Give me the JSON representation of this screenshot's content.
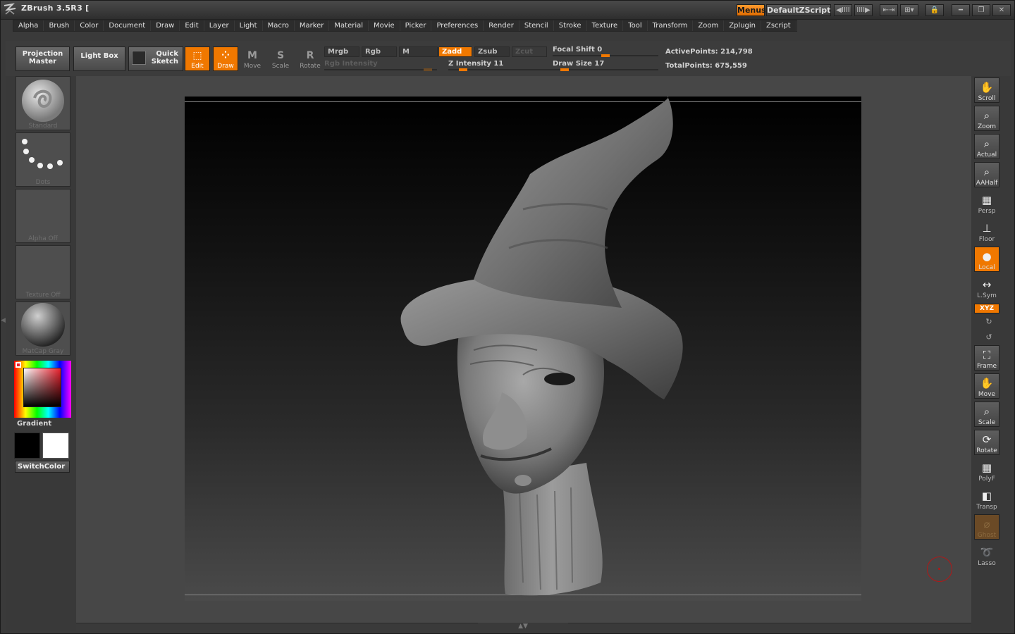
{
  "window": {
    "title": "ZBrush 3.5R3 [",
    "menus_button": "Menus",
    "script_name": "DefaultZScript",
    "controls": [
      "◀IIII",
      "IIII▶",
      "⇤⇥",
      "⊞▾",
      "🔒",
      "━",
      "❐",
      "✕"
    ]
  },
  "menubar": [
    "Alpha",
    "Brush",
    "Color",
    "Document",
    "Draw",
    "Edit",
    "Layer",
    "Light",
    "Macro",
    "Marker",
    "Material",
    "Movie",
    "Picker",
    "Preferences",
    "Render",
    "Stencil",
    "Stroke",
    "Texture",
    "Tool",
    "Transform",
    "Zoom",
    "Zplugin",
    "Zscript"
  ],
  "shelf": {
    "projection_master_1": "Projection",
    "projection_master_2": "Master",
    "light_box": "Light Box",
    "quick_sketch_1": "Quick",
    "quick_sketch_2": "Sketch",
    "edit": "Edit",
    "draw": "Draw",
    "move": "Move",
    "scale": "Scale",
    "rotate": "Rotate",
    "mrgb": "Mrgb",
    "rgb": "Rgb",
    "m": "M",
    "zadd": "Zadd",
    "zsub": "Zsub",
    "zcut": "Zcut",
    "rgb_intensity": "Rgb  Intensity",
    "z_intensity": "Z  Intensity 11",
    "focal_shift": "Focal  Shift 0",
    "draw_size": "Draw  Size 17",
    "active_points": "ActivePoints: 214,798",
    "total_points": "TotalPoints: 675,559"
  },
  "levels": {
    "rgb_intensity": 0.95,
    "z_intensity": 0.11,
    "focal_shift": 0.5,
    "draw_size": 0.08
  },
  "left_tray": {
    "brush": "Standard",
    "stroke": "Dots",
    "alpha": "Alpha  Off",
    "texture": "Texture  Off",
    "material": "MatCap  Gray",
    "gradient": "Gradient",
    "switch_color": "SwitchColor",
    "main_color": "#000000",
    "secondary_color": "#ffffff"
  },
  "right_tray": {
    "scroll": "Scroll",
    "zoom": "Zoom",
    "actual": "Actual",
    "aahalf": "AAHalf",
    "persp": "Persp",
    "floor": "Floor",
    "local": "Local",
    "lsym": "L.Sym",
    "xyz": "XYZ",
    "frame": "Frame",
    "move": "Move",
    "scale": "Scale",
    "rotate": "Rotate",
    "polyf": "PolyF",
    "transp": "Transp",
    "ghost": "Ghost",
    "lasso": "Lasso"
  },
  "colors": {
    "accent": "#f07800",
    "background": "#474747"
  }
}
